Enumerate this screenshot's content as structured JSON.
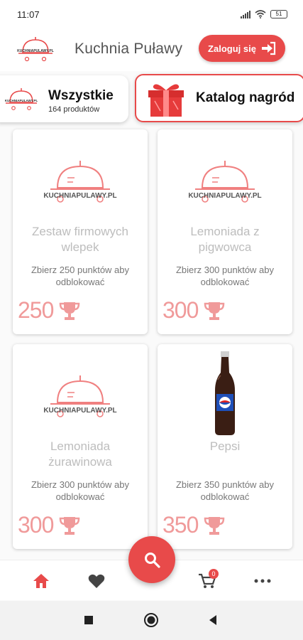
{
  "status_bar": {
    "time": "11:07",
    "battery": "51"
  },
  "header": {
    "logo": {
      "icon": "restaurant-cloche-logo",
      "text": "KUCHNIAPULAWY.PL"
    },
    "title": "Kuchnia Puławy",
    "login_label": "Zaloguj się"
  },
  "categories": {
    "all": {
      "title": "Wszystkie",
      "subtitle": "164 produktów"
    },
    "rewards": {
      "title": "Katalog nagród",
      "icon": "gift-icon"
    }
  },
  "products": [
    {
      "name": "Zestaw firmowych wlepek",
      "desc": "Zbierz 250 punktów aby odblokować",
      "points": "250",
      "image": "kuchnia-logo"
    },
    {
      "name": "Lemoniada z pigwowca",
      "desc": "Zbierz 300 punktów aby odblokować",
      "points": "300",
      "image": "kuchnia-logo"
    },
    {
      "name": "Lemoniada żurawinowa",
      "desc": "Zbierz 300 punktów aby odblokować",
      "points": "300",
      "image": "kuchnia-logo"
    },
    {
      "name": "Pepsi",
      "desc": "Zbierz 350 punktów aby odblokować",
      "points": "350",
      "image": "pepsi-bottle"
    }
  ],
  "bottom_nav": {
    "items": [
      "home-icon",
      "heart-icon",
      "search-icon",
      "cart-icon",
      "more-icon"
    ],
    "cart_count": "0"
  },
  "colors": {
    "accent": "#e84a4a",
    "points": "#f09a9a",
    "product_name": "#bdbdbd"
  }
}
